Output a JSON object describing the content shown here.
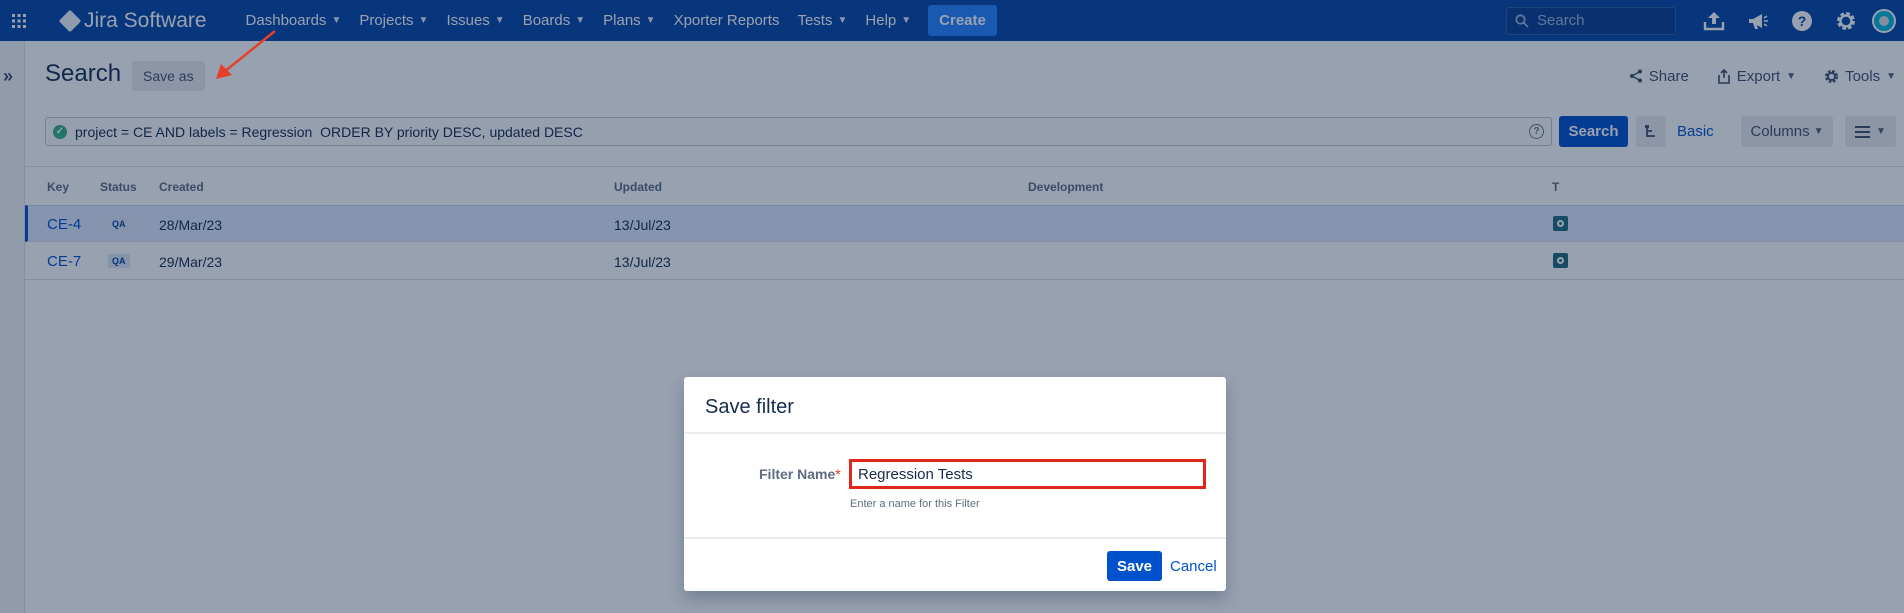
{
  "nav": {
    "product": "Jira Software",
    "items": [
      {
        "label": "Dashboards",
        "dropdown": true
      },
      {
        "label": "Projects",
        "dropdown": true
      },
      {
        "label": "Issues",
        "dropdown": true
      },
      {
        "label": "Boards",
        "dropdown": true
      },
      {
        "label": "Plans",
        "dropdown": true
      },
      {
        "label": "Xporter Reports",
        "dropdown": false
      },
      {
        "label": "Tests",
        "dropdown": true
      },
      {
        "label": "Help",
        "dropdown": true
      }
    ],
    "create_label": "Create",
    "search_placeholder": "Search",
    "icons": [
      "upload-icon",
      "megaphone-icon",
      "help-icon",
      "settings-icon",
      "avatar"
    ]
  },
  "header": {
    "title": "Search",
    "save_as_label": "Save as",
    "share_label": "Share",
    "export_label": "Export",
    "tools_label": "Tools"
  },
  "jql": {
    "query": "project = CE AND labels = Regression  ORDER BY priority DESC, updated DESC",
    "search_label": "Search",
    "basic_label": "Basic",
    "columns_label": "Columns"
  },
  "table": {
    "headers": {
      "key": "Key",
      "status": "Status",
      "created": "Created",
      "updated": "Updated",
      "development": "Development",
      "type": "T"
    },
    "rows": [
      {
        "key": "CE-4",
        "status": "QA",
        "created": "28/Mar/23",
        "updated": "13/Jul/23",
        "selected": true
      },
      {
        "key": "CE-7",
        "status": "QA",
        "created": "29/Mar/23",
        "updated": "13/Jul/23",
        "selected": false
      }
    ]
  },
  "dialog": {
    "title": "Save filter",
    "field_label": "Filter Name",
    "required_marker": "*",
    "field_value": "Regression Tests",
    "hint": "Enter a name for this Filter",
    "save_label": "Save",
    "cancel_label": "Cancel"
  },
  "colors": {
    "nav_bg": "#0747a6",
    "primary": "#0052cc",
    "highlight_border": "#e0281a",
    "annotation_arrow": "#e5402a"
  }
}
